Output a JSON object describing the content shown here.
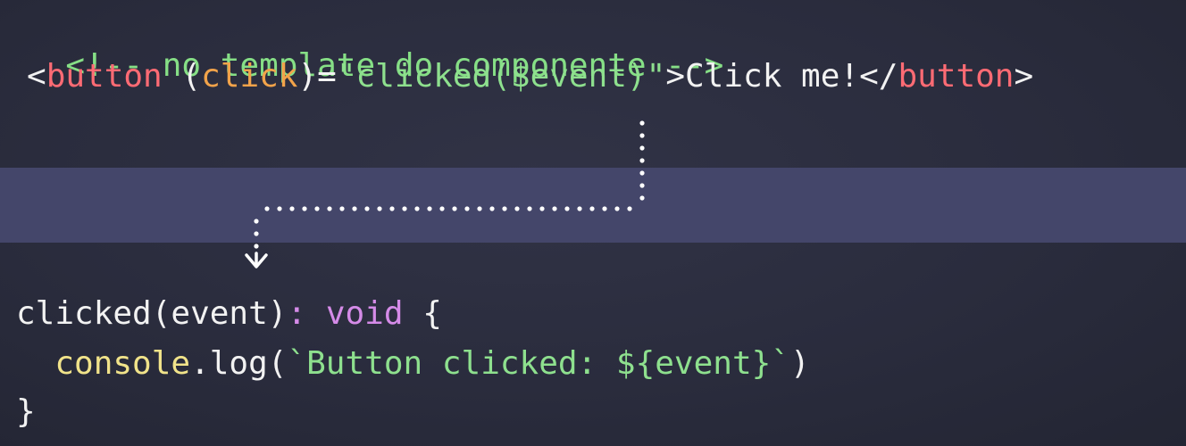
{
  "template_snippet": {
    "comment": "<!-- no template do componente -->",
    "open_lt": "<",
    "open_tag": "button",
    "space": " ",
    "paren_open": "(",
    "event_name": "click",
    "paren_close_eq": ")=",
    "handler_string": "\"clicked($event)\"",
    "open_gt": ">",
    "button_text": "Click me!",
    "close_lt": "</",
    "close_tag": "button",
    "close_gt": ">"
  },
  "component_method": {
    "signature_name": "clicked(event)",
    "colon": ":",
    "return_type": "void",
    "brace_open": "{",
    "indent": "  ",
    "console_obj": "console",
    "log_call": ".log(",
    "template_literal": "`Button clicked: ${event}`",
    "call_close": ")",
    "brace_close": "}"
  },
  "colors": {
    "background": "#2a2c3d",
    "band": "#44466a",
    "comment": "#86df86",
    "tag": "#ff6b74",
    "attribute": "#f2a34a",
    "string": "#8ee08e",
    "keyword": "#d58be8",
    "function": "#f1e38a",
    "text": "#f2f2f2"
  },
  "icons": {
    "flow_arrow": "dotted-down-arrow-icon"
  }
}
